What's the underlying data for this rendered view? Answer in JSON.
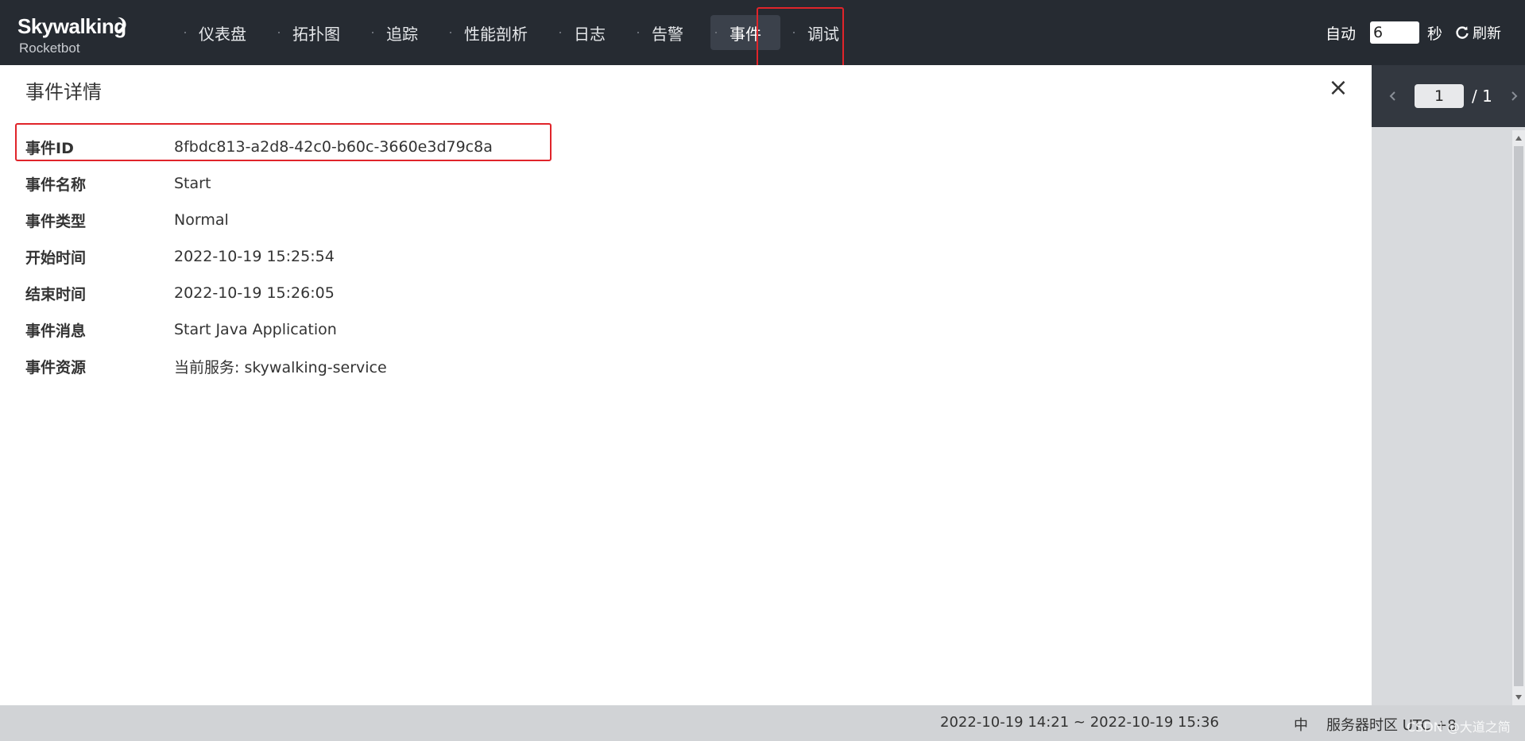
{
  "brand": {
    "name": "Skywalking",
    "subtitle": "Rocketbot"
  },
  "nav": {
    "items": [
      {
        "label": "仪表盘"
      },
      {
        "label": "拓扑图"
      },
      {
        "label": "追踪"
      },
      {
        "label": "性能剖析"
      },
      {
        "label": "日志"
      },
      {
        "label": "告警"
      },
      {
        "label": "事件",
        "active": true
      },
      {
        "label": "调试"
      }
    ]
  },
  "toolbar": {
    "auto_label": "自动",
    "auto_value": "6",
    "seconds_label": "秒",
    "refresh_label": "刷新"
  },
  "detail": {
    "title": "事件详情",
    "close": "×",
    "rows": [
      {
        "label": "事件ID",
        "value": "8fbdc813-a2d8-42c0-b60c-3660e3d79c8a"
      },
      {
        "label": "事件名称",
        "value": "Start"
      },
      {
        "label": "事件类型",
        "value": "Normal"
      },
      {
        "label": "开始时间",
        "value": "2022-10-19 15:25:54"
      },
      {
        "label": "结束时间",
        "value": "2022-10-19 15:26:05"
      },
      {
        "label": "事件消息",
        "value": "Start Java Application"
      },
      {
        "label": "事件资源",
        "value": "当前服务: skywalking-service"
      }
    ]
  },
  "pager": {
    "current": "1",
    "total": "/ 1"
  },
  "footer": {
    "time_range": "2022-10-19 14:21 ~ 2022-10-19 15:36",
    "lang": "中",
    "timezone": "服务器时区 UTC +8",
    "watermark": "CSDN @大道之简"
  },
  "colors": {
    "navbar": "#262b32",
    "highlight": "#e0242a",
    "side_panel": "#d8dadd",
    "footer": "#d1d3d6"
  }
}
